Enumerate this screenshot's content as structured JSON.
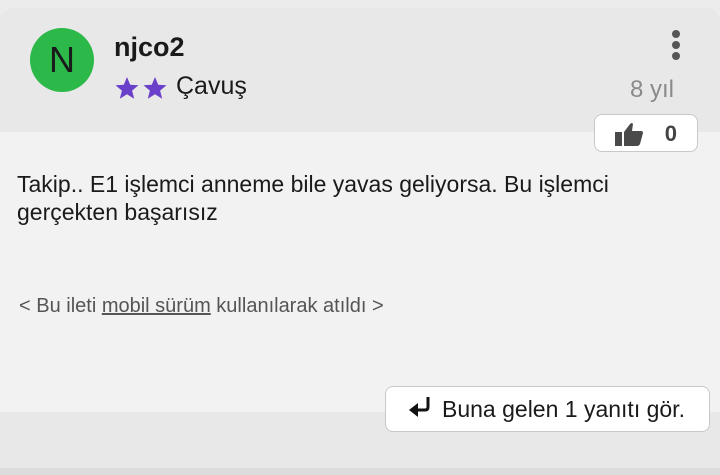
{
  "post": {
    "avatar_letter": "N",
    "avatar_color": "#2db84a",
    "username": "njco2",
    "rank": {
      "stars": 2,
      "star_color": "#6a3fc9",
      "label": "Çavuş"
    },
    "age": "8 yıl",
    "likes": "0",
    "body": "Takip.. E1 işlemci anneme bile yavas geliyorsa. Bu işlemci gerçekten başarısız",
    "mobile_note": {
      "prefix": "< Bu ileti ",
      "link": "mobil sürüm",
      "suffix": " kullanılarak atıldı >"
    },
    "reply_button_label": "Buna gelen 1 yanıtı gör."
  },
  "icons": {
    "menu": "more-vertical-icon",
    "like": "thumbs-up-icon",
    "reply": "reply-arrow-icon",
    "rank": "star-icon"
  }
}
